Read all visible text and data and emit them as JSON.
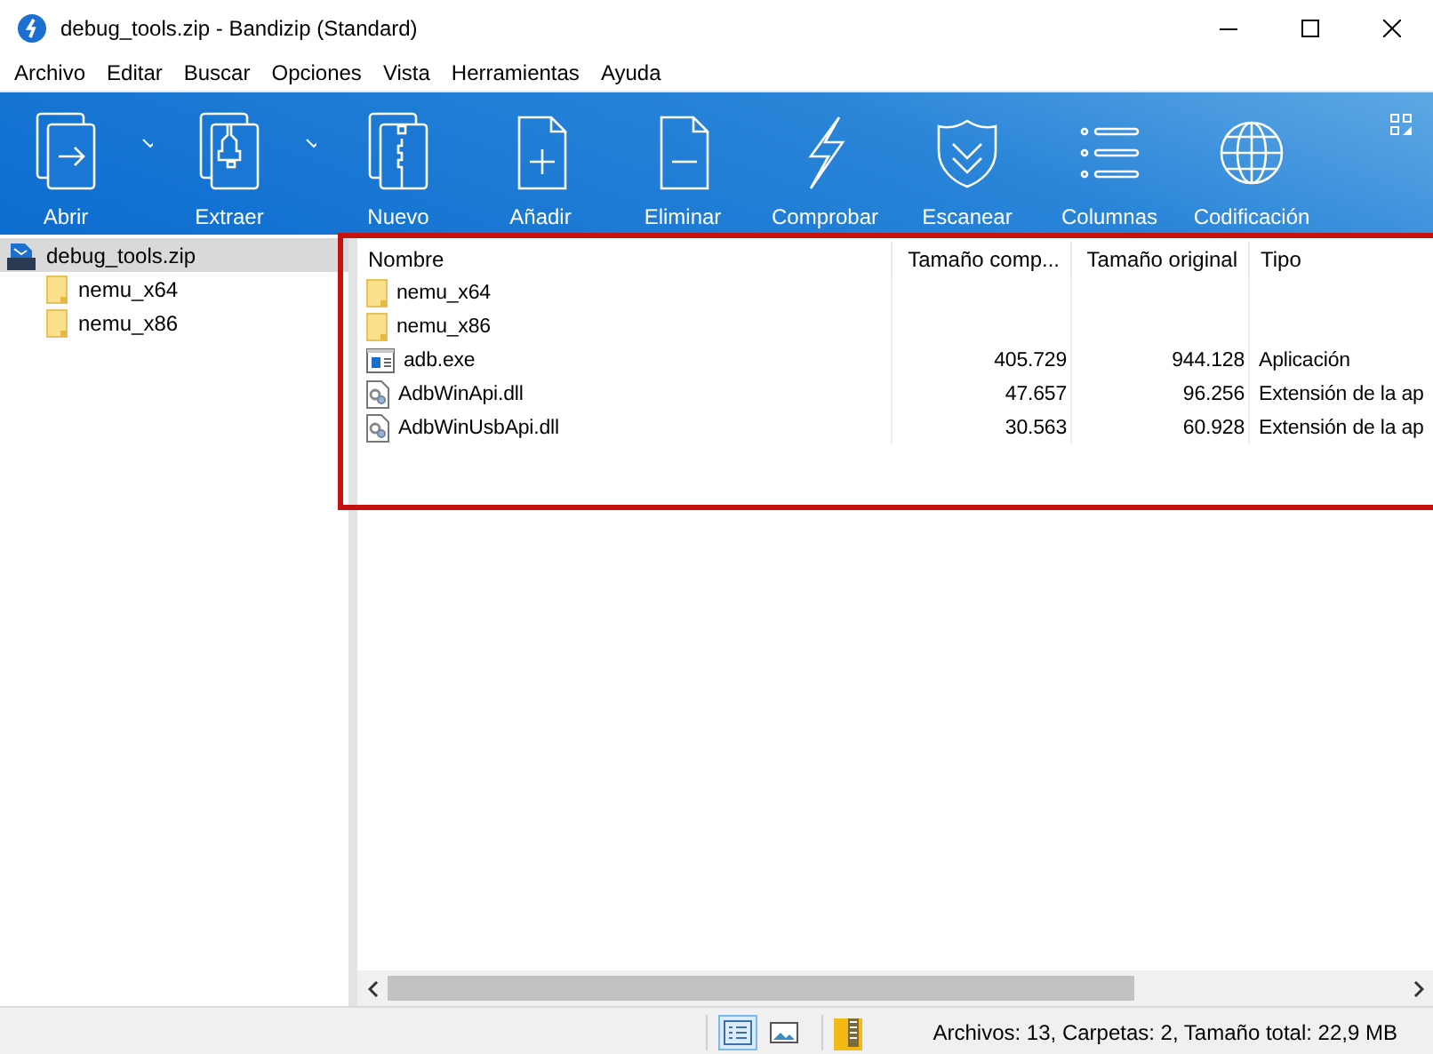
{
  "window": {
    "title": "debug_tools.zip - Bandizip (Standard)"
  },
  "menu": [
    "Archivo",
    "Editar",
    "Buscar",
    "Opciones",
    "Vista",
    "Herramientas",
    "Ayuda"
  ],
  "toolbar": [
    {
      "label": "Abrir",
      "has_dropdown": true
    },
    {
      "label": "Extraer",
      "has_dropdown": true
    },
    {
      "label": "Nuevo",
      "has_dropdown": false
    },
    {
      "label": "Añadir",
      "has_dropdown": false
    },
    {
      "label": "Eliminar",
      "has_dropdown": false
    },
    {
      "label": "Comprobar",
      "has_dropdown": false
    },
    {
      "label": "Escanear",
      "has_dropdown": false
    },
    {
      "label": "Columnas",
      "has_dropdown": false
    },
    {
      "label": "Codificación",
      "has_dropdown": false
    }
  ],
  "tree": {
    "label": "debug_tools.zip",
    "selected": true,
    "children": [
      {
        "label": "nemu_x64",
        "selected": false
      },
      {
        "label": "nemu_x86",
        "selected": false
      }
    ]
  },
  "table": {
    "columns": [
      "Nombre",
      "Tamaño comp...",
      "Tamaño original",
      "Tipo"
    ],
    "rows": [
      {
        "kind": "folder",
        "cells": [
          "nemu_x64"
        ]
      },
      {
        "kind": "folder",
        "cells": [
          "nemu_x86"
        ]
      },
      {
        "kind": "exe",
        "cells": [
          "adb.exe",
          "405.729",
          "944.128",
          "Aplicación"
        ]
      },
      {
        "kind": "dll",
        "cells": [
          "AdbWinApi.dll",
          "47.657",
          "96.256",
          "Extensión de la ap"
        ]
      },
      {
        "kind": "dll",
        "cells": [
          "AdbWinUsbApi.dll",
          "30.563",
          "60.928",
          "Extensión de la ap"
        ]
      }
    ]
  },
  "status_bar": {
    "view_buttons": [
      {
        "kind": "details",
        "selected": true
      },
      {
        "kind": "preview",
        "selected": false
      }
    ],
    "text": "Archivos: 13, Carpetas: 2, Tamaño total: 22,9 MB"
  }
}
